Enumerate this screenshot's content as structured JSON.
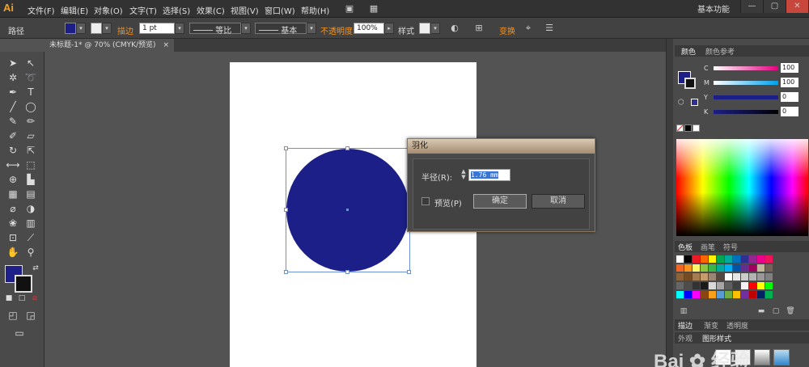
{
  "app": {
    "logo": "Ai",
    "workspace": "基本功能",
    "logo_color": "#f7a11a"
  },
  "menu": [
    "文件(F)",
    "编辑(E)",
    "对象(O)",
    "文字(T)",
    "选择(S)",
    "效果(C)",
    "视图(V)",
    "窗口(W)",
    "帮助(H)"
  ],
  "window_controls": [
    "—",
    "▢",
    "✕"
  ],
  "control_bar": {
    "object_type": "路径",
    "stroke_label": "描边",
    "stroke_weight": "1 pt",
    "profile_uniform": "等比",
    "brush_basic": "基本",
    "opacity_label": "不透明度",
    "opacity_value": "100%",
    "style_label": "样式",
    "transform_label": "变换",
    "fill_color": "#1c1f87"
  },
  "document_tab": {
    "title": "未标题-1* @ 70% (CMYK/预览)",
    "close": "×"
  },
  "canvas": {
    "shape_fill": "#1c1f87",
    "selection_color": "#6c8fd6"
  },
  "feather_dialog": {
    "title": "羽化",
    "radius_label": "半径(R):",
    "radius_value": "1.76 mm",
    "preview_label": "预览(P)",
    "preview_checked": false,
    "ok_label": "确定",
    "cancel_label": "取消"
  },
  "color_panel": {
    "tabs": [
      "颜色",
      "颜色参考"
    ],
    "sliders": [
      {
        "label": "C",
        "value": "100",
        "color": "linear-gradient(to right,#fff,#e4007f)"
      },
      {
        "label": "M",
        "value": "100",
        "color": "linear-gradient(to right,#fff,#00a0e9)"
      },
      {
        "label": "Y",
        "value": "0",
        "color": "linear-gradient(to right,#1c1f87,#1c1f87)"
      },
      {
        "label": "K",
        "value": "0",
        "color": "linear-gradient(to right,#1c1f87,#000)"
      }
    ]
  },
  "swatches_panel": {
    "tabs": [
      "色板",
      "画笔",
      "符号"
    ],
    "colors": [
      "#ffffff",
      "#000000",
      "#ed1c24",
      "#ff6600",
      "#fff200",
      "#00a651",
      "#00a99d",
      "#0072bc",
      "#2e3192",
      "#92278f",
      "#ec008c",
      "#ed145b",
      "#f26522",
      "#f7941d",
      "#fff568",
      "#8dc63f",
      "#39b54a",
      "#00a99d",
      "#00aeef",
      "#0054a6",
      "#662d91",
      "#9e005d",
      "#c2b59b",
      "#736357",
      "#8c6239",
      "#754c24",
      "#a67c52",
      "#c69c6d",
      "#998675",
      "#534741",
      "#ffffff",
      "#e6e6e6",
      "#cccccc",
      "#b3b3b3",
      "#999999",
      "#808080",
      "#666666",
      "#4d4d4d",
      "#333333",
      "#1a1a1a",
      "#d9d9d9",
      "#a6a6a6",
      "#5e5e5e",
      "#404040",
      "#f2f2f2",
      "#ff0000",
      "#ffff00",
      "#00ff00",
      "#00ffff",
      "#0000ff",
      "#ff00ff",
      "#8b4513",
      "#f7a11a",
      "#5b9bd5",
      "#70ad47",
      "#ffc000",
      "#7030a0",
      "#c00000",
      "#002060",
      "#00b050"
    ]
  },
  "stroke_panel": {
    "tabs": [
      "描边",
      "渐变",
      "透明度"
    ],
    "subtabs": [
      "外观",
      "图形样式"
    ]
  },
  "watermark": "Bai 经验"
}
